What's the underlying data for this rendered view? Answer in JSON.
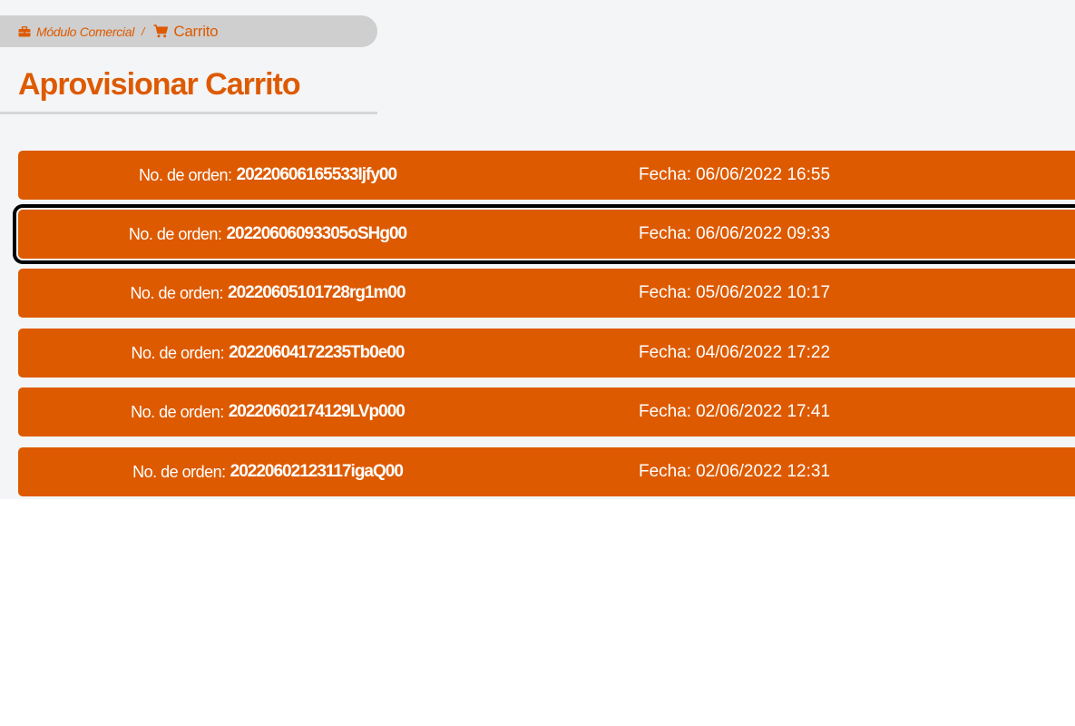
{
  "breadcrumb": {
    "module_label": "Módulo Comercial",
    "separator": "/",
    "cart_label": "Carrito"
  },
  "page": {
    "title": "Aprovisionar Carrito"
  },
  "colors": {
    "accent": "#dd5a00",
    "background": "#f4f5f7",
    "breadcrumb_bg": "#cfcfcf"
  },
  "orders": {
    "order_label": "No. de orden:",
    "date_label": "Fecha:",
    "items": [
      {
        "order_no": "20220606165533Ijfy00",
        "date": "06/06/2022 16:55",
        "selected": false
      },
      {
        "order_no": "20220606093305oSHg00",
        "date": "06/06/2022 09:33",
        "selected": true
      },
      {
        "order_no": "20220605101728rg1m00",
        "date": "05/06/2022 10:17",
        "selected": false
      },
      {
        "order_no": "20220604172235Tb0e00",
        "date": "04/06/2022 17:22",
        "selected": false
      },
      {
        "order_no": "20220602174129LVp000",
        "date": "02/06/2022 17:41",
        "selected": false
      },
      {
        "order_no": "20220602123117igaQ00",
        "date": "02/06/2022 12:31",
        "selected": false
      }
    ]
  }
}
